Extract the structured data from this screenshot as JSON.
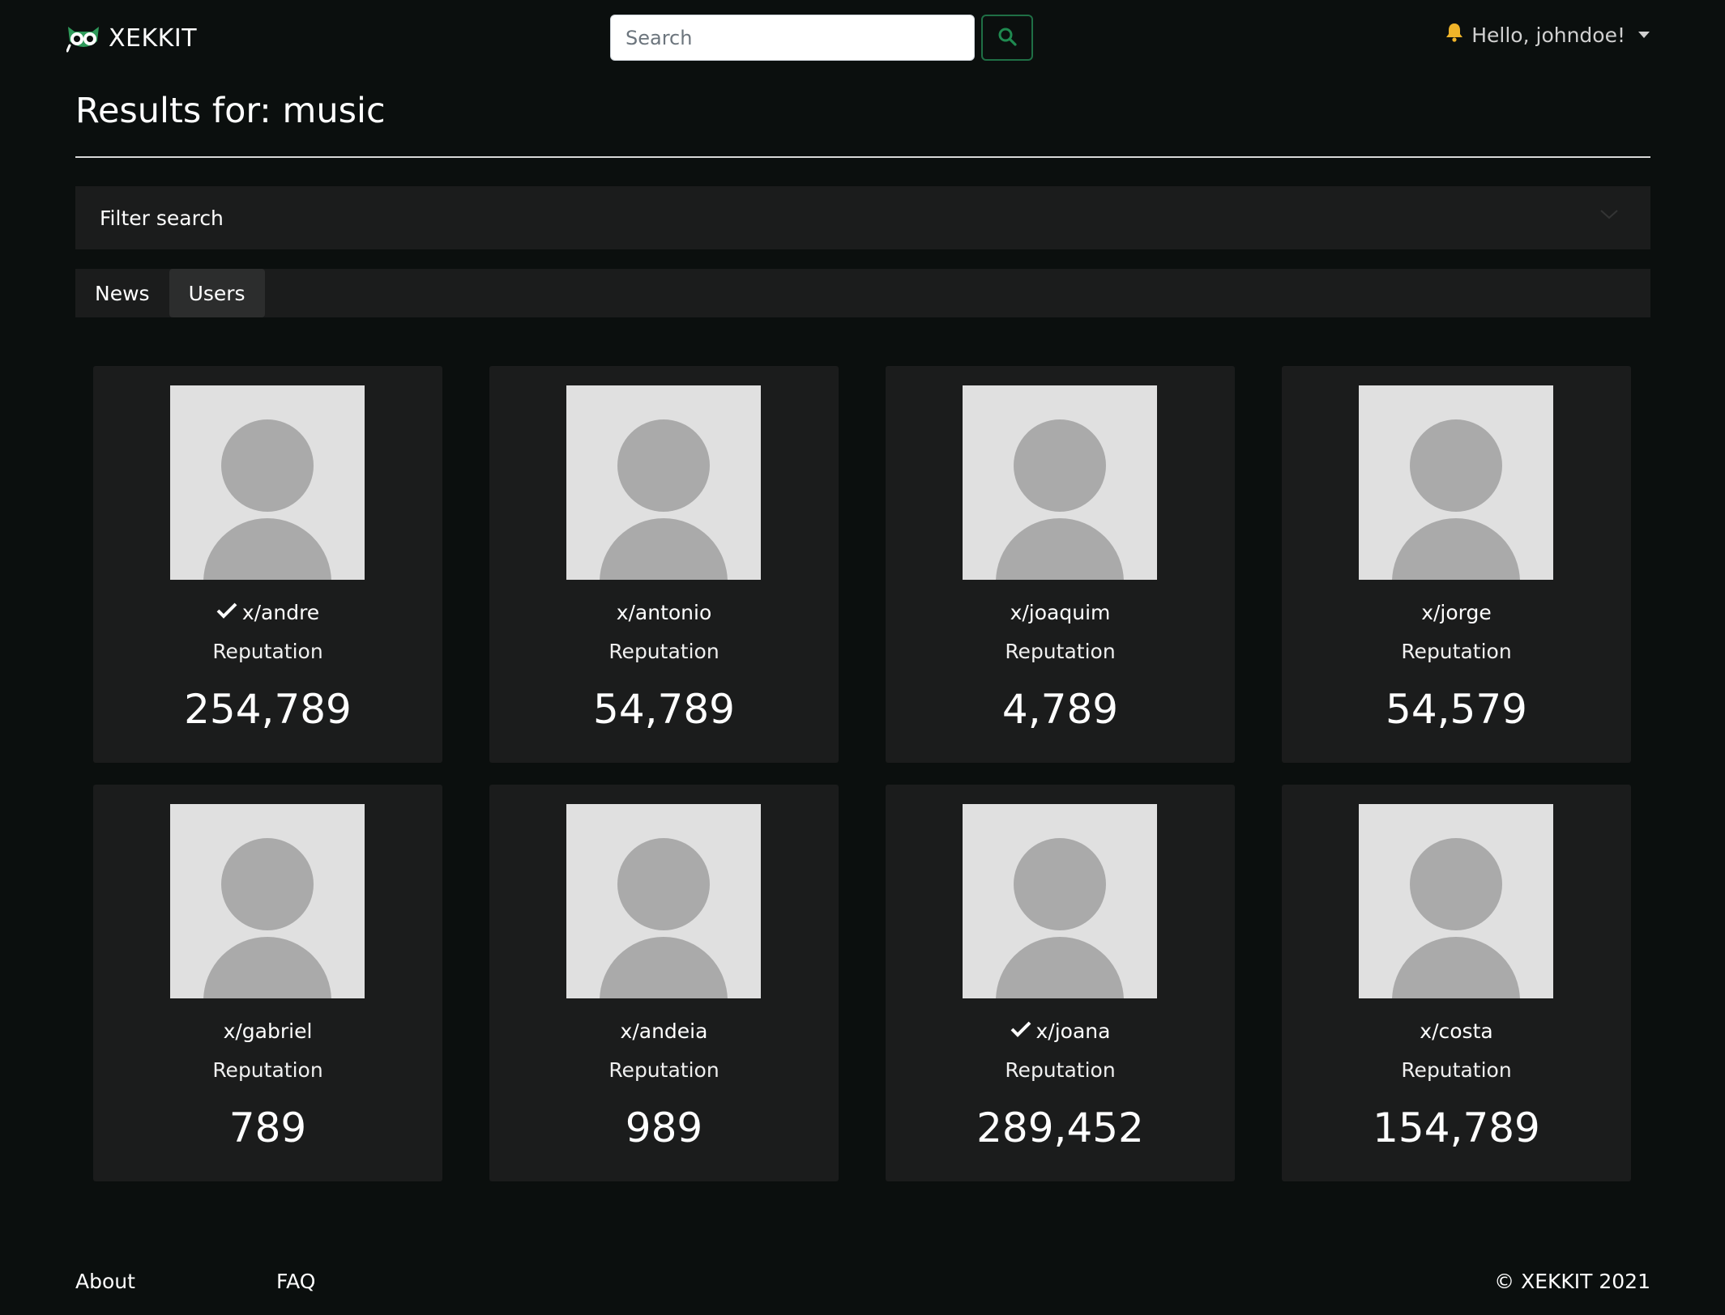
{
  "brand": {
    "name": "XEKKIT"
  },
  "search": {
    "placeholder": "Search"
  },
  "user_menu": {
    "greeting": "Hello, johndoe!"
  },
  "page": {
    "title": "Results for: music"
  },
  "filter": {
    "label": "Filter search"
  },
  "tabs": [
    {
      "label": "News",
      "active": false
    },
    {
      "label": "Users",
      "active": true
    }
  ],
  "users": [
    {
      "username": "x/andre",
      "verified": true,
      "reputation_label": "Reputation",
      "reputation": "254,789"
    },
    {
      "username": "x/antonio",
      "verified": false,
      "reputation_label": "Reputation",
      "reputation": "54,789"
    },
    {
      "username": "x/joaquim",
      "verified": false,
      "reputation_label": "Reputation",
      "reputation": "4,789"
    },
    {
      "username": "x/jorge",
      "verified": false,
      "reputation_label": "Reputation",
      "reputation": "54,579"
    },
    {
      "username": "x/gabriel",
      "verified": false,
      "reputation_label": "Reputation",
      "reputation": "789"
    },
    {
      "username": "x/andeia",
      "verified": false,
      "reputation_label": "Reputation",
      "reputation": "989"
    },
    {
      "username": "x/joana",
      "verified": true,
      "reputation_label": "Reputation",
      "reputation": "289,452"
    },
    {
      "username": "x/costa",
      "verified": false,
      "reputation_label": "Reputation",
      "reputation": "154,789"
    }
  ],
  "footer": {
    "about": "About",
    "faq": "FAQ",
    "copyright": "© XEKKIT 2021"
  },
  "colors": {
    "background": "#0b0f0e",
    "panel": "#1b1c1c",
    "accent_green": "#1f8a50",
    "bell": "#f0b429"
  },
  "icons": {
    "logo": "owl-logo-icon",
    "search_button": "search-icon",
    "notifications": "bell-icon",
    "dropdown": "caret-down-icon",
    "filter_toggle": "chevron-down-icon",
    "verified": "checkmark-icon",
    "avatar": "default-avatar-icon"
  }
}
